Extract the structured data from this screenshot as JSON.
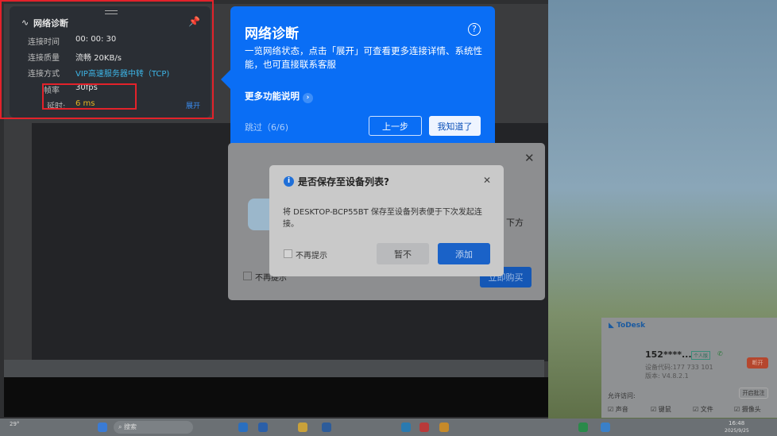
{
  "diag_panel": {
    "title": "网络诊断",
    "rows": [
      {
        "label": "连接时间",
        "value": "00: 00: 30"
      },
      {
        "label": "连接质量",
        "value": "流畅 20KB/s"
      },
      {
        "label": "连接方式",
        "value": "VIP高速服务器中转（TCP)"
      },
      {
        "label": "帧率",
        "value": "30fps"
      },
      {
        "label": "延时:",
        "value": "6 ms"
      }
    ],
    "expand": "展开"
  },
  "tooltip": {
    "title": "网络诊断",
    "body": "一览网络状态，点击「展开」可查看更多连接详情、系统性能，也可直接联系客服",
    "more": "更多功能说明",
    "skip": "跳过（6/6)",
    "prev": "上一步",
    "ok": "我知道了"
  },
  "back_dialog": {
    "side_text": "下方",
    "dont_show": "不再提示",
    "buy": "立即购买"
  },
  "dialog": {
    "title": "是否保存至设备列表?",
    "body": "将 DESKTOP-BCP55BT 保存至设备列表便于下次发起连接。",
    "dont_show": "不再提示",
    "cancel": "暂不",
    "add": "添加"
  },
  "todesk": {
    "brand": "ToDesk",
    "user": "152****...",
    "badge": "个人版",
    "device_code": "设备代码:177 733 101",
    "version": "版本: V4.8.2.1",
    "disconnect": "断开",
    "allow": "允许访问:",
    "enable_note": "开启批注",
    "perms": [
      "声音",
      "键鼠",
      "文件",
      "摄像头"
    ]
  },
  "taskbar": {
    "search": "搜索",
    "time": "16:48",
    "date": "2025/9/25",
    "weather": "29°"
  },
  "colors": {
    "accent": "#0a6ef5",
    "highlight": "#e3222a",
    "latency": "#e6b422",
    "link": "#3db6e8"
  }
}
